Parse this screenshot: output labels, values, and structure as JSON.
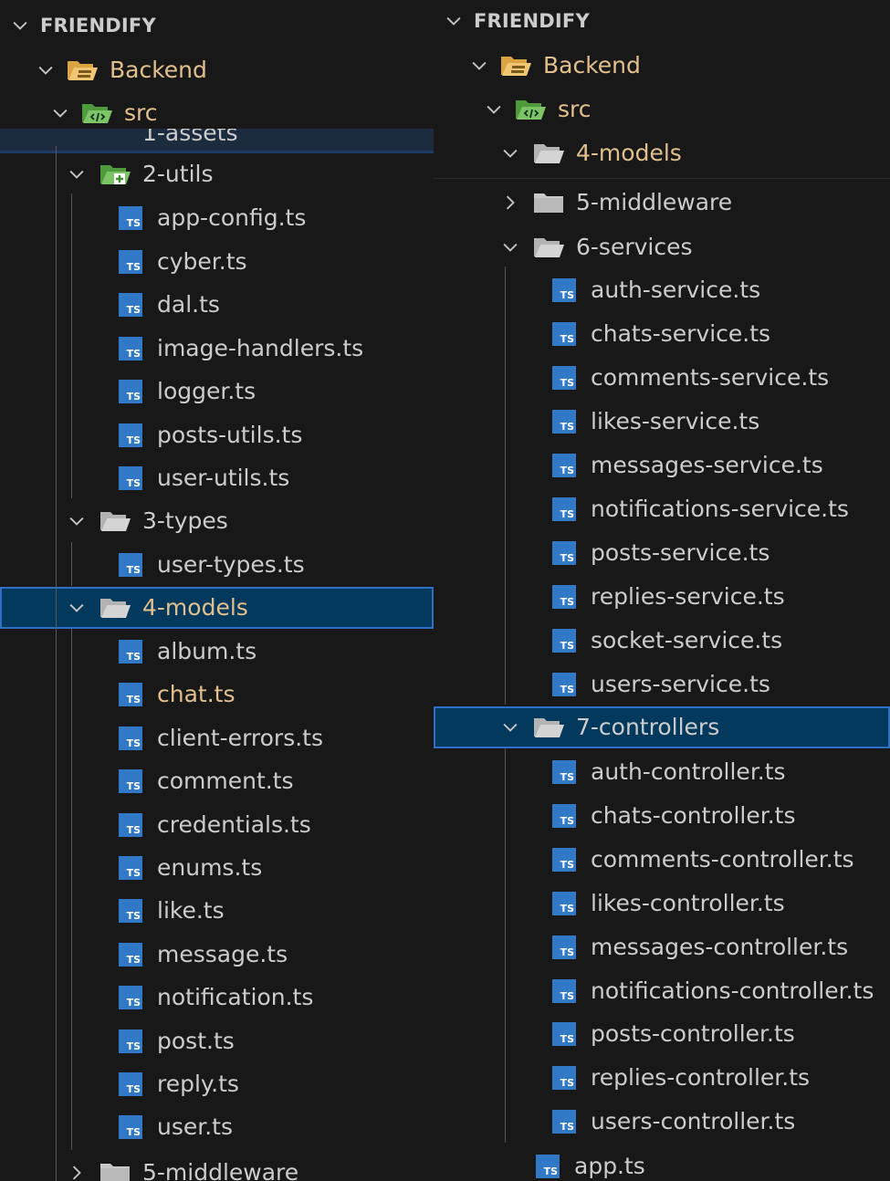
{
  "left": {
    "root": "FRIENDIFY",
    "backend": "Backend",
    "src": "src",
    "assets_peek": "1-assets",
    "utils_folder": "2-utils",
    "utils_files": [
      "app-config.ts",
      "cyber.ts",
      "dal.ts",
      "image-handlers.ts",
      "logger.ts",
      "posts-utils.ts",
      "user-utils.ts"
    ],
    "types_folder": "3-types",
    "types_files": [
      "user-types.ts"
    ],
    "models_folder": "4-models",
    "models_files": [
      "album.ts",
      "chat.ts",
      "client-errors.ts",
      "comment.ts",
      "credentials.ts",
      "enums.ts",
      "like.ts",
      "message.ts",
      "notification.ts",
      "post.ts",
      "reply.ts",
      "user.ts"
    ],
    "middleware_peek": "5-middleware"
  },
  "right": {
    "root": "FRIENDIFY",
    "backend": "Backend",
    "src": "src",
    "models_folder": "4-models",
    "middleware_folder": "5-middleware",
    "services_folder": "6-services",
    "services_files": [
      "auth-service.ts",
      "chats-service.ts",
      "comments-service.ts",
      "likes-service.ts",
      "messages-service.ts",
      "notifications-service.ts",
      "posts-service.ts",
      "replies-service.ts",
      "socket-service.ts",
      "users-service.ts"
    ],
    "controllers_folder": "7-controllers",
    "controllers_files": [
      "auth-controller.ts",
      "chats-controller.ts",
      "comments-controller.ts",
      "likes-controller.ts",
      "messages-controller.ts",
      "notifications-controller.ts",
      "posts-controller.ts",
      "replies-controller.ts",
      "users-controller.ts"
    ],
    "app_file": "app.ts"
  },
  "icons": {
    "ts_badge": "TS",
    "chevron_down": "chevron-down-icon",
    "chevron_right": "chevron-right-icon",
    "folder": "folder-icon",
    "special_folder": "special-folder-icon"
  },
  "colors": {
    "background": "#181818",
    "text": "#cccccc",
    "modified_text": "#e2c08d",
    "ts_blue": "#3178c6",
    "selection": "#04395e",
    "selection_border": "#2f6fc4"
  }
}
